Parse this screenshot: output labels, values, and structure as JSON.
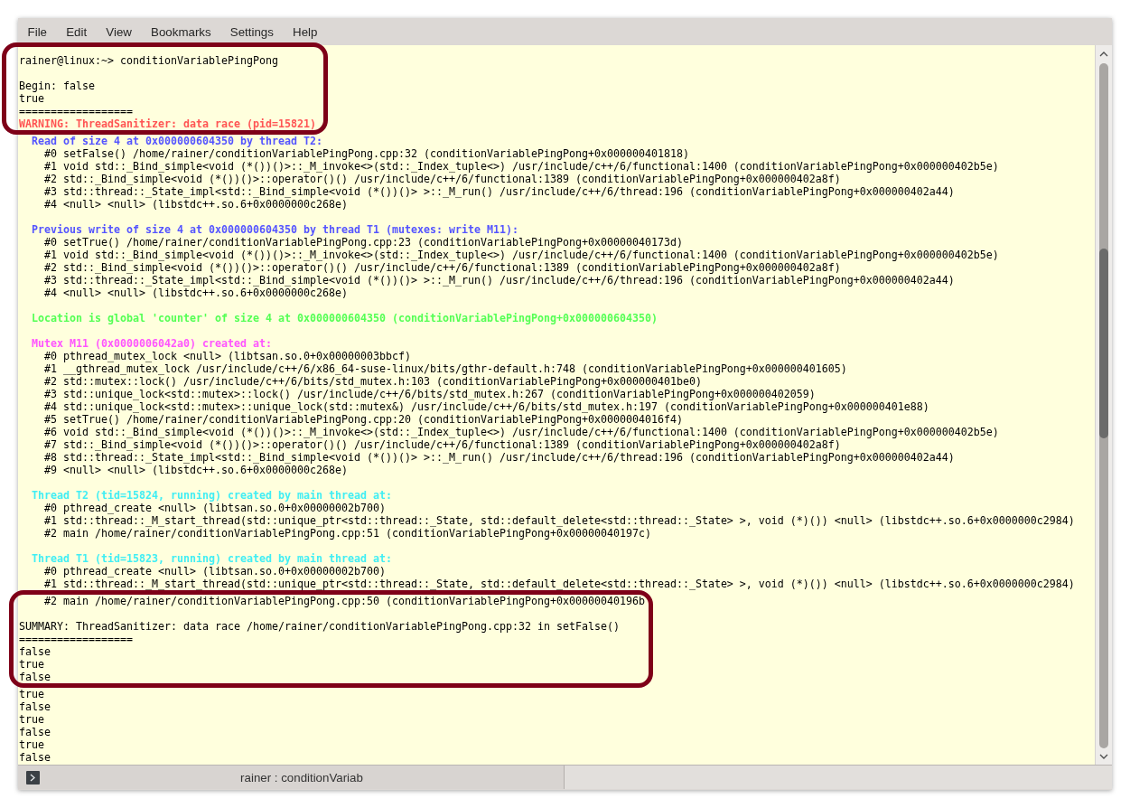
{
  "menu": [
    "File",
    "Edit",
    "View",
    "Bookmarks",
    "Settings",
    "Help"
  ],
  "terminal": {
    "prompt": "rainer@linux:~> conditionVariablePingPong",
    "output_before": [
      "Begin: false",
      "true",
      "=================="
    ],
    "warning": "WARNING: ThreadSanitizer: data race (pid=15821)",
    "sections": [
      {
        "kind": "access",
        "header": "Read of size 4 at 0x000000604350 by thread T2:",
        "frames": [
          "#0 setFalse() /home/rainer/conditionVariablePingPong.cpp:32 (conditionVariablePingPong+0x000000401818)",
          "#1 void std::_Bind_simple<void (*())()>::_M_invoke<>(std::_Index_tuple<>) /usr/include/c++/6/functional:1400 (conditionVariablePingPong+0x000000402b5e)",
          "#2 std::_Bind_simple<void (*())()>::operator()() /usr/include/c++/6/functional:1389 (conditionVariablePingPong+0x000000402a8f)",
          "#3 std::thread::_State_impl<std::_Bind_simple<void (*())()> >::_M_run() /usr/include/c++/6/thread:196 (conditionVariablePingPong+0x000000402a44)",
          "#4 <null> <null> (libstdc++.so.6+0x0000000c268e)"
        ]
      },
      {
        "kind": "access",
        "header": "Previous write of size 4 at 0x000000604350 by thread T1 (mutexes: write M11):",
        "frames": [
          "#0 setTrue() /home/rainer/conditionVariablePingPong.cpp:23 (conditionVariablePingPong+0x00000040173d)",
          "#1 void std::_Bind_simple<void (*())()>::_M_invoke<>(std::_Index_tuple<>) /usr/include/c++/6/functional:1400 (conditionVariablePingPong+0x000000402b5e)",
          "#2 std::_Bind_simple<void (*())()>::operator()() /usr/include/c++/6/functional:1389 (conditionVariablePingPong+0x000000402a8f)",
          "#3 std::thread::_State_impl<std::_Bind_simple<void (*())()> >::_M_run() /usr/include/c++/6/thread:196 (conditionVariablePingPong+0x000000402a44)",
          "#4 <null> <null> (libstdc++.so.6+0x0000000c268e)"
        ]
      },
      {
        "kind": "location",
        "header": "Location is global 'counter' of size 4 at 0x000000604350 (conditionVariablePingPong+0x000000604350)"
      },
      {
        "kind": "mutex",
        "header": "Mutex M11 (0x0000006042a0) created at:",
        "frames": [
          "#0 pthread_mutex_lock <null> (libtsan.so.0+0x00000003bbcf)",
          "#1 __gthread_mutex_lock /usr/include/c++/6/x86_64-suse-linux/bits/gthr-default.h:748 (conditionVariablePingPong+0x000000401605)",
          "#2 std::mutex::lock() /usr/include/c++/6/bits/std_mutex.h:103 (conditionVariablePingPong+0x000000401be0)",
          "#3 std::unique_lock<std::mutex>::lock() /usr/include/c++/6/bits/std_mutex.h:267 (conditionVariablePingPong+0x000000402059)",
          "#4 std::unique_lock<std::mutex>::unique_lock(std::mutex&) /usr/include/c++/6/bits/std_mutex.h:197 (conditionVariablePingPong+0x000000401e88)",
          "#5 setTrue() /home/rainer/conditionVariablePingPong.cpp:20 (conditionVariablePingPong+0x0000004016f4)",
          "#6 void std::_Bind_simple<void (*())()>::_M_invoke<>(std::_Index_tuple<>) /usr/include/c++/6/functional:1400 (conditionVariablePingPong+0x000000402b5e)",
          "#7 std::_Bind_simple<void (*())()>::operator()() /usr/include/c++/6/functional:1389 (conditionVariablePingPong+0x000000402a8f)",
          "#8 std::thread::_State_impl<std::_Bind_simple<void (*())()> >::_M_run() /usr/include/c++/6/thread:196 (conditionVariablePingPong+0x000000402a44)",
          "#9 <null> <null> (libstdc++.so.6+0x0000000c268e)"
        ]
      },
      {
        "kind": "thread",
        "header": "Thread T2 (tid=15824, running) created by main thread at:",
        "frames": [
          "#0 pthread_create <null> (libtsan.so.0+0x00000002b700)",
          "#1 std::thread::_M_start_thread(std::unique_ptr<std::thread::_State, std::default_delete<std::thread::_State> >, void (*)()) <null> (libstdc++.so.6+0x0000000c2984)",
          "#2 main /home/rainer/conditionVariablePingPong.cpp:51 (conditionVariablePingPong+0x00000040197c)"
        ]
      },
      {
        "kind": "thread",
        "header": "Thread T1 (tid=15823, running) created by main thread at:",
        "frames": [
          "#0 pthread_create <null> (libtsan.so.0+0x00000002b700)",
          "#1 std::thread::_M_start_thread(std::unique_ptr<std::thread::_State, std::default_delete<std::thread::_State> >, void (*)()) <null> (libstdc++.so.6+0x0000000c2984)",
          "#2 main /home/rainer/conditionVariablePingPong.cpp:50 (conditionVariablePingPong+0x00000040196b"
        ]
      }
    ],
    "summary": "SUMMARY: ThreadSanitizer: data race /home/rainer/conditionVariablePingPong.cpp:32 in setFalse()",
    "output_after": [
      "==================",
      "false",
      "true",
      "false",
      "true",
      "false",
      "true",
      "false",
      "true",
      "false"
    ]
  },
  "tabs": [
    {
      "label": "rainer : conditionVariab",
      "selected": true
    }
  ]
}
